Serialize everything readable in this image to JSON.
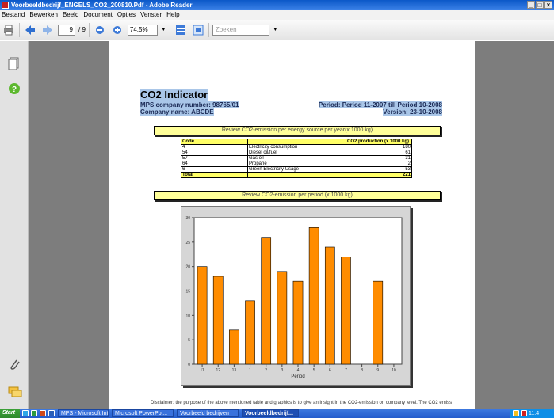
{
  "window": {
    "title": "Voorbeeldbedrijf_ENGELS_CO2_200810.Pdf - Adobe Reader",
    "controls": [
      "_",
      "□",
      "×"
    ]
  },
  "menu": [
    "Bestand",
    "Bewerken",
    "Beeld",
    "Document",
    "Opties",
    "Venster",
    "Help"
  ],
  "toolbar": {
    "page_current": "9",
    "page_total": "/ 9",
    "zoom": "74,5%",
    "search_placeholder": "Zoeken"
  },
  "document": {
    "title": "CO2 Indicator",
    "company_number": "MPS company number:  98765/01",
    "company_name": "Company name: ABCDE",
    "period": "Period: Period 11-2007 till Period 10-2008",
    "version": "Version: 23-10-2008",
    "section1": "Review CO2-emission per energy source per year(x 1000 kg)",
    "table": {
      "headers": [
        "Code",
        "",
        "CO2 production (x 1000 kg)"
      ],
      "rows": [
        [
          "4",
          "Electricity consumption",
          "180"
        ],
        [
          "54",
          "Diesel oil/fuel",
          "61"
        ],
        [
          "57",
          "Gas oil",
          "31"
        ],
        [
          "64",
          "Propane",
          "2"
        ],
        [
          "6",
          "Green Electricity Usage",
          "-53"
        ]
      ],
      "total": [
        "Total",
        "",
        "221"
      ]
    },
    "section2": "Review CO2-emission per period (x 1000 kg)",
    "disclaimer": "Disclaimer: the purpose of the above mentioned table and graphics is to give an insight in the CO2-emission on company level. The CO2 emiss"
  },
  "chart_data": {
    "type": "bar",
    "categories": [
      "11",
      "12",
      "13",
      "1",
      "2",
      "3",
      "4",
      "5",
      "6",
      "7",
      "8",
      "9",
      "10"
    ],
    "values": [
      20,
      18,
      7,
      13,
      26,
      19,
      17,
      28,
      24,
      22,
      0,
      17,
      0
    ],
    "xlabel": "Period",
    "ylabel": "",
    "ylim": [
      0,
      30
    ],
    "yticks": [
      "0",
      "5",
      "10",
      "15",
      "20",
      "25",
      "30"
    ],
    "bar_color": "#ff8c00"
  },
  "taskbar": {
    "start": "Start",
    "tasks": [
      "MPS - Microsoft Int...",
      "Microsoft PowerPoi...",
      "Voorbeeld bedrijven",
      "Voorbeeldbedrijf..."
    ],
    "clock": "11:4"
  },
  "colors": {
    "titlebar": "#0b58c8",
    "highlight": "#a9c6e8",
    "yellow": "#ffff99",
    "viewer_bg": "#7d7d7d"
  }
}
